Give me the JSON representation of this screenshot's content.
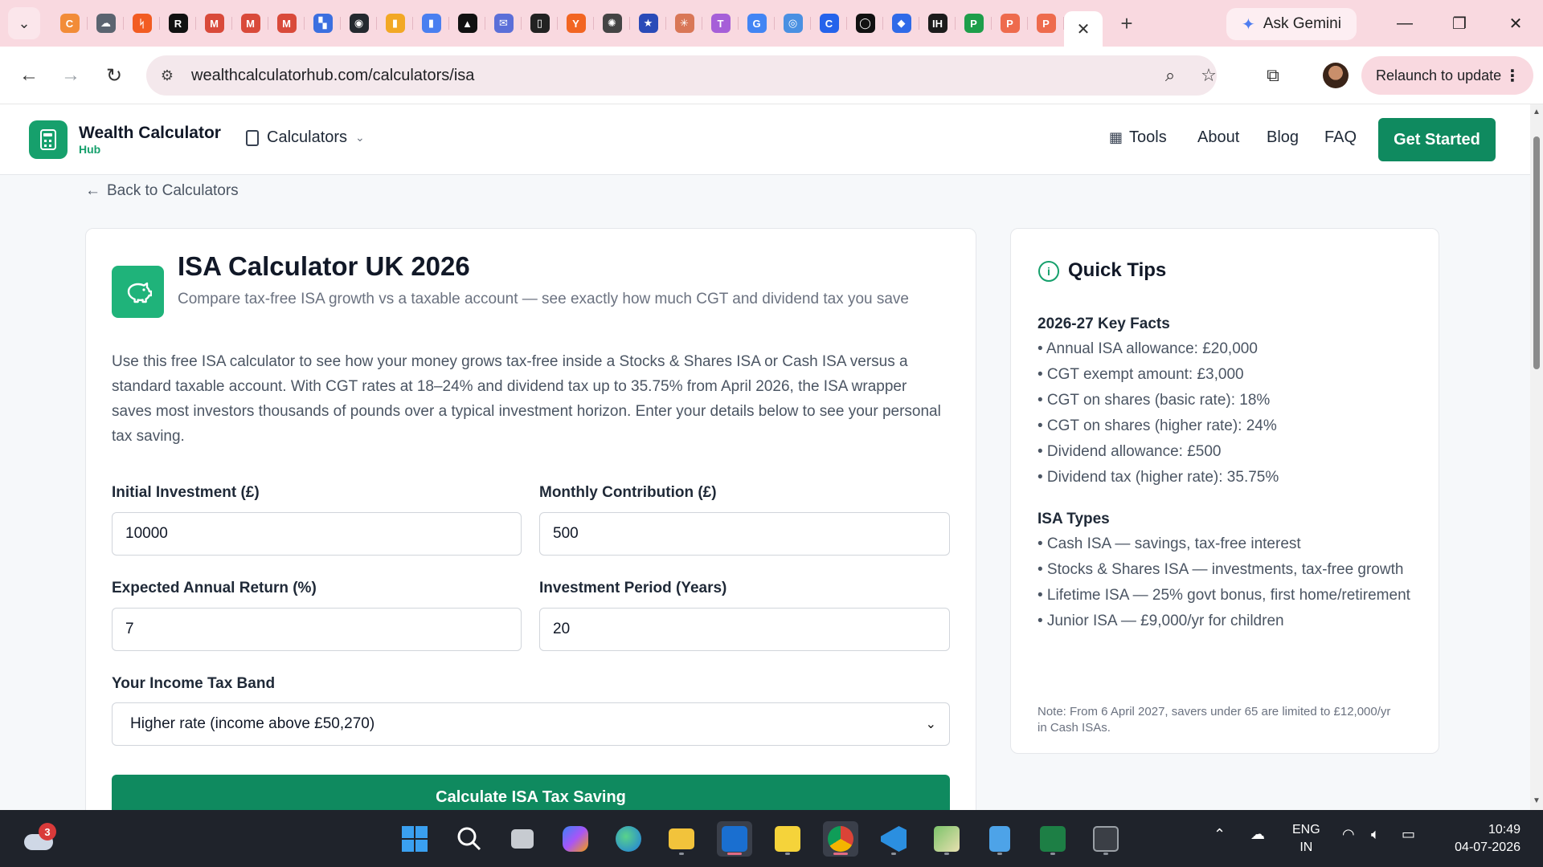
{
  "browser": {
    "pinned_tabs": [
      {
        "icon": "orange-c",
        "color": "#f28c38",
        "glyph": "C"
      },
      {
        "icon": "cloud-icon",
        "color": "#5b6470",
        "glyph": "☁"
      },
      {
        "icon": "orange-zap",
        "color": "#f25c22",
        "glyph": "ᛋ"
      },
      {
        "icon": "black-r",
        "color": "#111111",
        "glyph": "R"
      },
      {
        "icon": "gmail-icon",
        "color": "#d94a3a",
        "glyph": "M"
      },
      {
        "icon": "gmail-icon",
        "color": "#d94a3a",
        "glyph": "M"
      },
      {
        "icon": "gmail-icon",
        "color": "#d94a3a",
        "glyph": "M"
      },
      {
        "icon": "bookmark-blue",
        "color": "#3b6fe0",
        "glyph": "▚"
      },
      {
        "icon": "github-icon",
        "color": "#24292f",
        "glyph": "◉"
      },
      {
        "icon": "analytics-icon",
        "color": "#f2a825",
        "glyph": "▮"
      },
      {
        "icon": "analytics-blue",
        "color": "#4a7ff0",
        "glyph": "▮"
      },
      {
        "icon": "triangle-icon",
        "color": "#111111",
        "glyph": "▲"
      },
      {
        "icon": "inbox-icon",
        "color": "#5b6fd8",
        "glyph": "✉"
      },
      {
        "icon": "notion-icon",
        "color": "#222222",
        "glyph": "▯"
      },
      {
        "icon": "ycombinator-icon",
        "color": "#f26522",
        "glyph": "Y"
      },
      {
        "icon": "openai-icon",
        "color": "#444444",
        "glyph": "✺"
      },
      {
        "icon": "shield-icon",
        "color": "#2a4bb8",
        "glyph": "★"
      },
      {
        "icon": "claude-icon",
        "color": "#d97757",
        "glyph": "✳"
      },
      {
        "icon": "translate-icon",
        "color": "#a65fd8",
        "glyph": "T"
      },
      {
        "icon": "google-icon",
        "color": "#4285f4",
        "glyph": "G"
      },
      {
        "icon": "chrome-blue",
        "color": "#4a90e2",
        "glyph": "◎"
      },
      {
        "icon": "c-blue",
        "color": "#2563eb",
        "glyph": "C"
      },
      {
        "icon": "circle-black",
        "color": "#111111",
        "glyph": "◯"
      },
      {
        "icon": "diamond-blue",
        "color": "#2f6ae8",
        "glyph": "◆"
      },
      {
        "icon": "ih-icon",
        "color": "#1c1c1c",
        "glyph": "IH"
      },
      {
        "icon": "p-green",
        "color": "#1e9e4a",
        "glyph": "P"
      },
      {
        "icon": "p-orange",
        "color": "#ee6b4d",
        "glyph": "P"
      },
      {
        "icon": "p-orange",
        "color": "#ee6b4d",
        "glyph": "P"
      }
    ],
    "gemini_label": "Ask Gemini",
    "url": "wealthcalculatorhub.com/calculators/isa",
    "relaunch_label": "Relaunch to update"
  },
  "site": {
    "brand_name": "Wealth Calculator",
    "brand_sub": "Hub",
    "calculators_menu": "Calculators",
    "nav": {
      "tools": "Tools",
      "about": "About",
      "blog": "Blog",
      "faq": "FAQ"
    },
    "cta": "Get Started",
    "back_link": "Back to Calculators"
  },
  "calculator": {
    "title": "ISA Calculator UK 2026",
    "subtitle": "Compare tax-free ISA growth vs a taxable account — see exactly how much CGT and dividend tax you save",
    "intro": "Use this free ISA calculator to see how your money grows tax-free inside a Stocks & Shares ISA or Cash ISA versus a standard taxable account. With CGT rates at 18–24% and dividend tax up to 35.75% from April 2026, the ISA wrapper saves most investors thousands of pounds over a typical investment horizon. Enter your details below to see your personal tax saving.",
    "fields": {
      "initial": {
        "label": "Initial Investment (£)",
        "value": "10000"
      },
      "monthly": {
        "label": "Monthly Contribution (£)",
        "value": "500"
      },
      "return": {
        "label": "Expected Annual Return (%)",
        "value": "7"
      },
      "period": {
        "label": "Investment Period (Years)",
        "value": "20"
      },
      "band": {
        "label": "Your Income Tax Band",
        "value": "Higher rate (income above £50,270)"
      }
    },
    "submit": "Calculate ISA Tax Saving"
  },
  "tips": {
    "title": "Quick Tips",
    "facts_heading": "2026-27 Key Facts",
    "facts": [
      "• Annual ISA allowance: £20,000",
      "• CGT exempt amount: £3,000",
      "• CGT on shares (basic rate): 18%",
      "• CGT on shares (higher rate): 24%",
      "• Dividend allowance: £500",
      "• Dividend tax (higher rate): 35.75%"
    ],
    "types_heading": "ISA Types",
    "types": [
      "• Cash ISA — savings, tax-free interest",
      "• Stocks & Shares ISA — investments, tax-free growth",
      "• Lifetime ISA — 25% govt bonus, first home/retirement",
      "• Junior ISA — £9,000/yr for children"
    ],
    "note": "Note: From 6 April 2027, savers under 65 are limited to £12,000/yr in Cash ISAs."
  },
  "taskbar": {
    "weather_badge": "3",
    "lang_top": "ENG",
    "lang_bottom": "IN",
    "time": "10:49",
    "date": "04-07-2026"
  },
  "colors": {
    "brand_green": "#0f8a5f",
    "tab_strip": "#f9d9e0"
  }
}
